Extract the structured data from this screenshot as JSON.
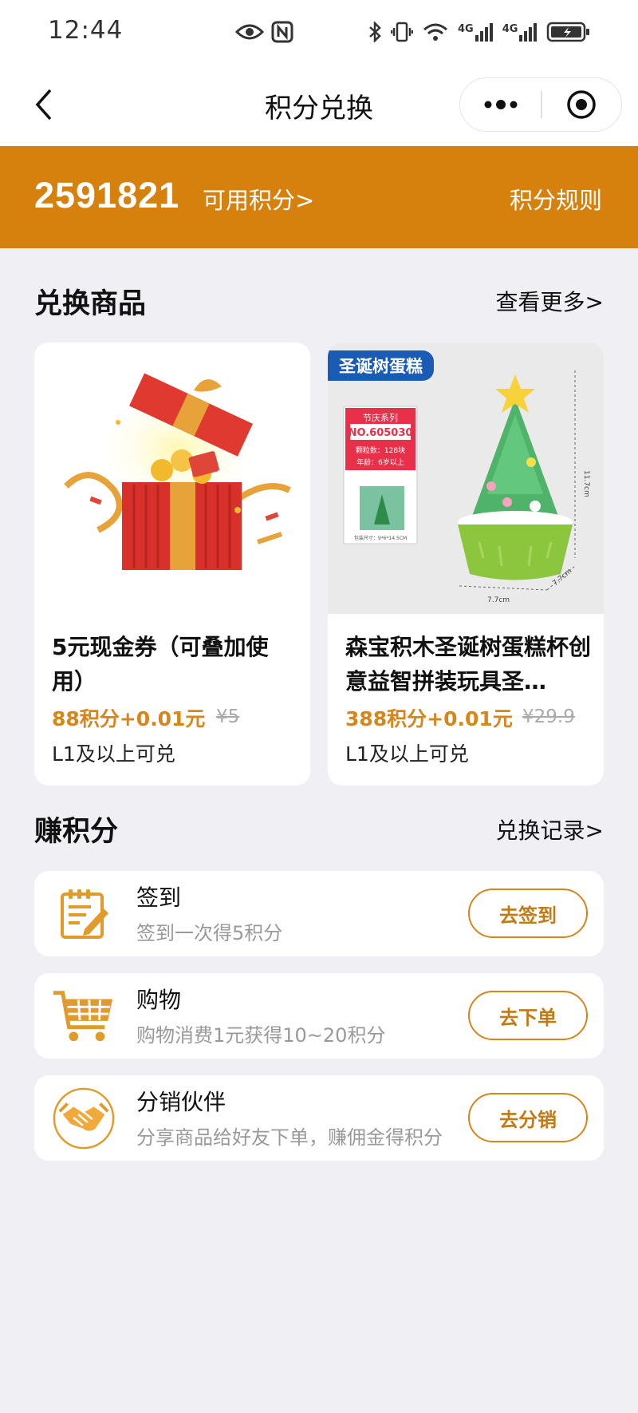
{
  "status_bar": {
    "time": "12:44",
    "network_left": "4G",
    "network_right": "4G"
  },
  "nav": {
    "title": "积分兑换"
  },
  "banner": {
    "points": "2591821",
    "available_label": "可用积分>",
    "rules_label": "积分规则"
  },
  "exchange": {
    "title": "兑换商品",
    "more_label": "查看更多>",
    "products": [
      {
        "name": "5元现金券（可叠加使用）",
        "price": "88积分+0.01元",
        "original": "¥5",
        "level": "L1及以上可兑"
      },
      {
        "tag": "圣诞树蛋糕",
        "name": "森宝积木圣诞树蛋糕杯创意益智拼装玩具圣…",
        "price": "388积分+0.01元",
        "original": "¥29.9",
        "level": "L1及以上可兑",
        "box_series": "节庆系列",
        "box_no": "NO.605030",
        "box_pieces": "颗粒数：128块",
        "box_age": "年龄：6岁以上",
        "box_size": "包装尺寸：9*6*14.5CM",
        "dim_height": "11.7cm",
        "dim_width": "7.7cm",
        "dim_depth": "7.7cm"
      }
    ]
  },
  "earn": {
    "title": "赚积分",
    "record_label": "兑换记录>",
    "items": [
      {
        "title": "签到",
        "desc": "签到一次得5积分",
        "button": "去签到",
        "icon": "sign-in-notepad-icon"
      },
      {
        "title": "购物",
        "desc": "购物消费1元获得10~20积分",
        "button": "去下单",
        "icon": "shopping-cart-icon"
      },
      {
        "title": "分销伙伴",
        "desc": "分享商品给好友下单，赚佣金得积分",
        "button": "去分销",
        "icon": "handshake-icon"
      }
    ]
  },
  "colors": {
    "accent": "#d6810d",
    "price": "#d6861a",
    "tag_blue": "#1a5cb5",
    "background": "#f0f0f4"
  }
}
